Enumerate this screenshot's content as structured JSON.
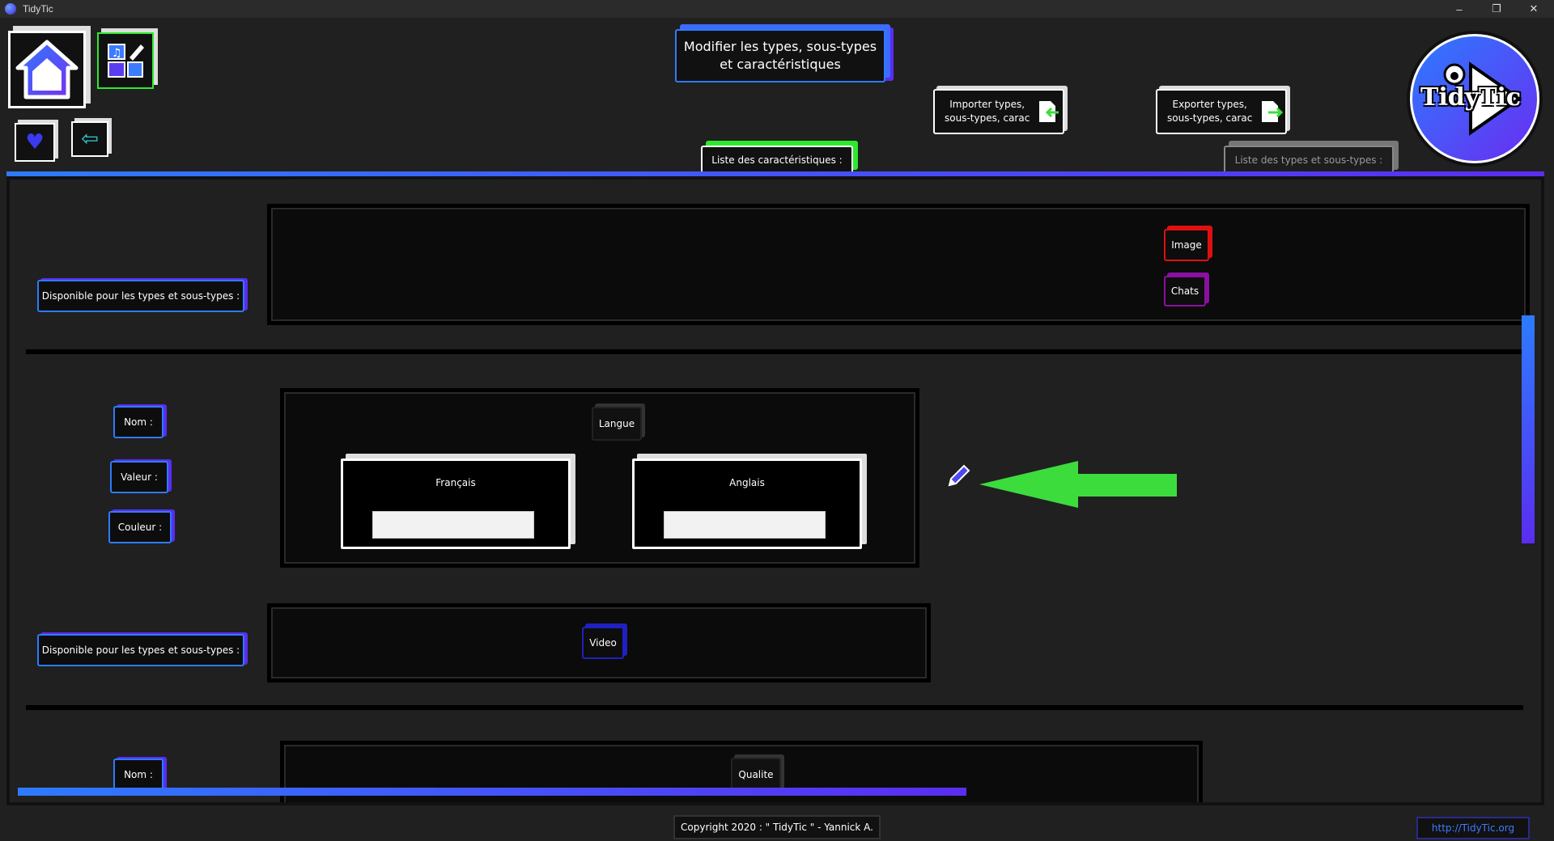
{
  "window": {
    "title": "TidyTic",
    "minimize": "–",
    "restore": "❐",
    "close": "✕"
  },
  "header": {
    "page_title_line1": "Modifier les types, sous-types",
    "page_title_line2": "et caractéristiques",
    "import_label_line1": "Importer types,",
    "import_label_line2": "sous-types, carac",
    "export_label_line1": "Exporter types,",
    "export_label_line2": "sous-types, carac",
    "logo_text": "TidyTic"
  },
  "tabs": {
    "characteristics": "Liste des caractéristiques :",
    "types": "Liste des types et sous-types :"
  },
  "colors": {
    "accent_blue": "#2d7bff",
    "accent_purple": "#5a2df0",
    "accent_green": "#3ddc3d",
    "image_red": "#e01010",
    "chats_purple": "#8a10a0",
    "video_blue": "#2020c0"
  },
  "section1": {
    "available_label": "Disponible pour les types et sous-types :",
    "tags": [
      "Image",
      "Chats"
    ]
  },
  "section2": {
    "name_label": "Nom :",
    "value_label": "Valeur :",
    "color_label": "Couleur :",
    "characteristic_name": "Langue",
    "values": [
      {
        "title": "Français",
        "input": ""
      },
      {
        "title": "Anglais",
        "input": ""
      }
    ],
    "edit_icon": "pencil-icon",
    "available_label": "Disponible pour les types et sous-types :",
    "tags": [
      "Video"
    ]
  },
  "section3": {
    "name_label": "Nom :",
    "characteristic_name": "Qualite"
  },
  "footer": {
    "copyright": "Copyright 2020 : \" TidyTic \" - Yannick A.",
    "link": "http://TidyTic.org"
  }
}
